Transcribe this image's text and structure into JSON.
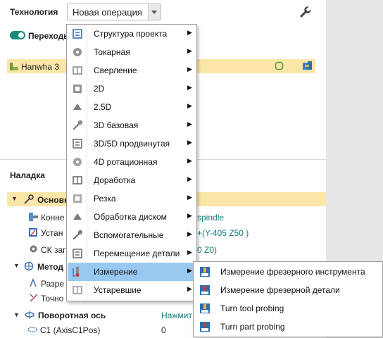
{
  "header": {
    "technology_label": "Технология",
    "operation_select_value": "Новая операция",
    "transitions_label": "Переходы"
  },
  "machine_row": {
    "label": "Hanwha 3"
  },
  "setup": {
    "title": "Наладка",
    "main_group": "Основн",
    "rows": [
      {
        "label": "Конне",
        "value": "spindle"
      },
      {
        "label": "Устан",
        "value": "+(Y-405 Z50 )"
      },
      {
        "label": "СК заг",
        "value": "0 Z0)"
      }
    ],
    "method_group": "Метод",
    "method_rows": [
      {
        "label": "Разре"
      },
      {
        "label": "Точно"
      }
    ],
    "rotary_axis": {
      "label": "Поворотная ось",
      "value": "Нажмит"
    },
    "c1": {
      "label": "C1 (AxisC1Pos)",
      "value": "0"
    }
  },
  "menu": {
    "items": [
      {
        "label": "Структура проекта",
        "icon": "project-structure-icon"
      },
      {
        "label": "Токарная",
        "icon": "turning-icon"
      },
      {
        "label": "Сверление",
        "icon": "drilling-icon"
      },
      {
        "label": "2D",
        "icon": "2d-icon"
      },
      {
        "label": "2.5D",
        "icon": "2-5d-icon"
      },
      {
        "label": "3D базовая",
        "icon": "3d-basic-icon"
      },
      {
        "label": "3D/5D продвинутая",
        "icon": "3d-5d-advanced-icon"
      },
      {
        "label": "4D ротационная",
        "icon": "4d-rotary-icon"
      },
      {
        "label": "Доработка",
        "icon": "rework-icon"
      },
      {
        "label": "Резка",
        "icon": "cutting-icon"
      },
      {
        "label": "Обработка диском",
        "icon": "disk-machining-icon"
      },
      {
        "label": "Вспомогательные",
        "icon": "auxiliary-icon"
      },
      {
        "label": "Перемещение детали",
        "icon": "part-transfer-icon"
      },
      {
        "label": "Измерение",
        "icon": "measurement-icon"
      },
      {
        "label": "Устаревшие",
        "icon": "deprecated-icon"
      }
    ],
    "active_index": 13
  },
  "submenu": {
    "items": [
      {
        "label": "Измерение фрезерного инструмента",
        "icon": "mill-tool-probe-icon"
      },
      {
        "label": "Измерение фрезерной детали",
        "icon": "mill-part-probe-icon"
      },
      {
        "label": "Turn tool probing",
        "icon": "turn-tool-probe-icon"
      },
      {
        "label": "Turn part probing",
        "icon": "turn-part-probe-icon"
      }
    ]
  },
  "colors": {
    "highlight_row": "#fbe6a8",
    "menu_active": "#99c9f0",
    "toggle_on": "#1a8a7a",
    "teal_text": "#137a78"
  }
}
